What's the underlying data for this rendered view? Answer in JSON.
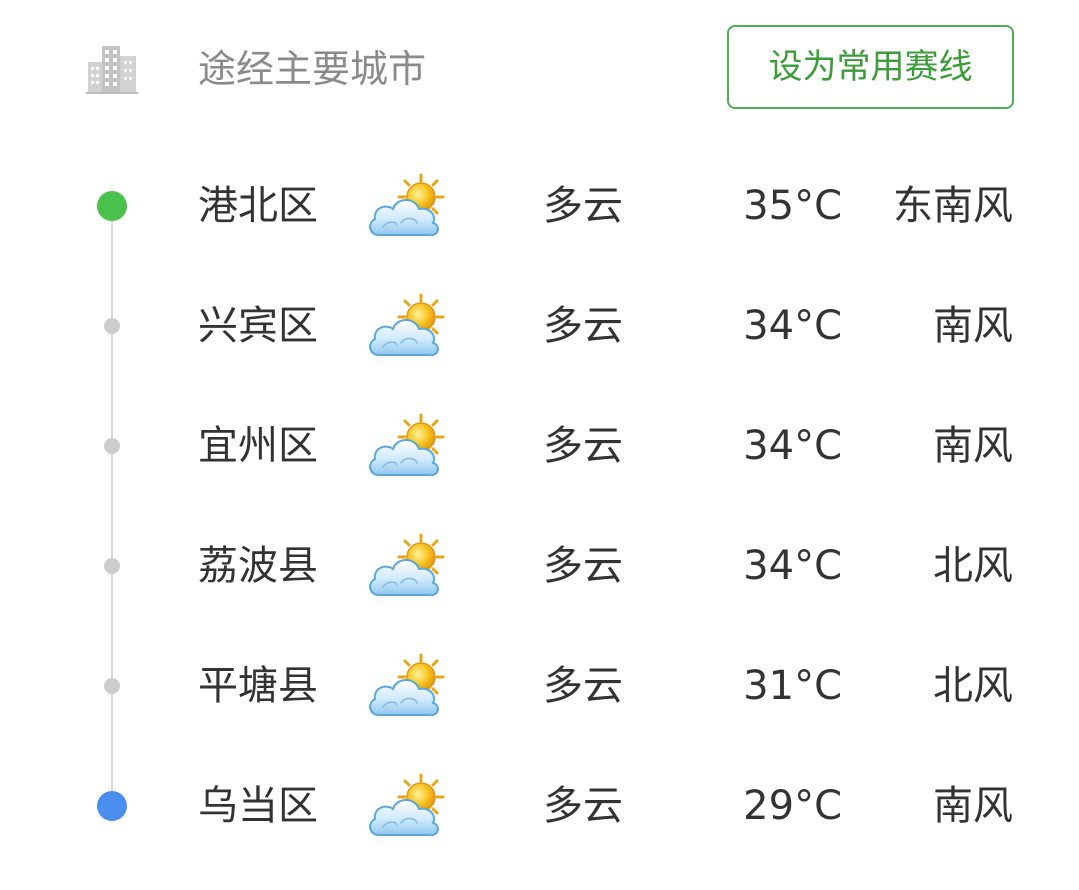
{
  "header": {
    "title": "途经主要城市",
    "icon": "building-icon",
    "set_route_label": "设为常用赛线"
  },
  "colors": {
    "start_dot": "#4ac14a",
    "end_dot": "#4a8ff0",
    "mid_dot": "#cccccc",
    "button_accent": "#4caf50"
  },
  "cities": [
    {
      "name": "港北区",
      "icon": "partly-cloudy-icon",
      "condition": "多云",
      "temp": "35°C",
      "wind": "东南风"
    },
    {
      "name": "兴宾区",
      "icon": "partly-cloudy-icon",
      "condition": "多云",
      "temp": "34°C",
      "wind": "南风"
    },
    {
      "name": "宜州区",
      "icon": "partly-cloudy-icon",
      "condition": "多云",
      "temp": "34°C",
      "wind": "南风"
    },
    {
      "name": "荔波县",
      "icon": "partly-cloudy-icon",
      "condition": "多云",
      "temp": "34°C",
      "wind": "北风"
    },
    {
      "name": "平塘县",
      "icon": "partly-cloudy-icon",
      "condition": "多云",
      "temp": "31°C",
      "wind": "北风"
    },
    {
      "name": "乌当区",
      "icon": "partly-cloudy-icon",
      "condition": "多云",
      "temp": "29°C",
      "wind": "南风"
    }
  ]
}
